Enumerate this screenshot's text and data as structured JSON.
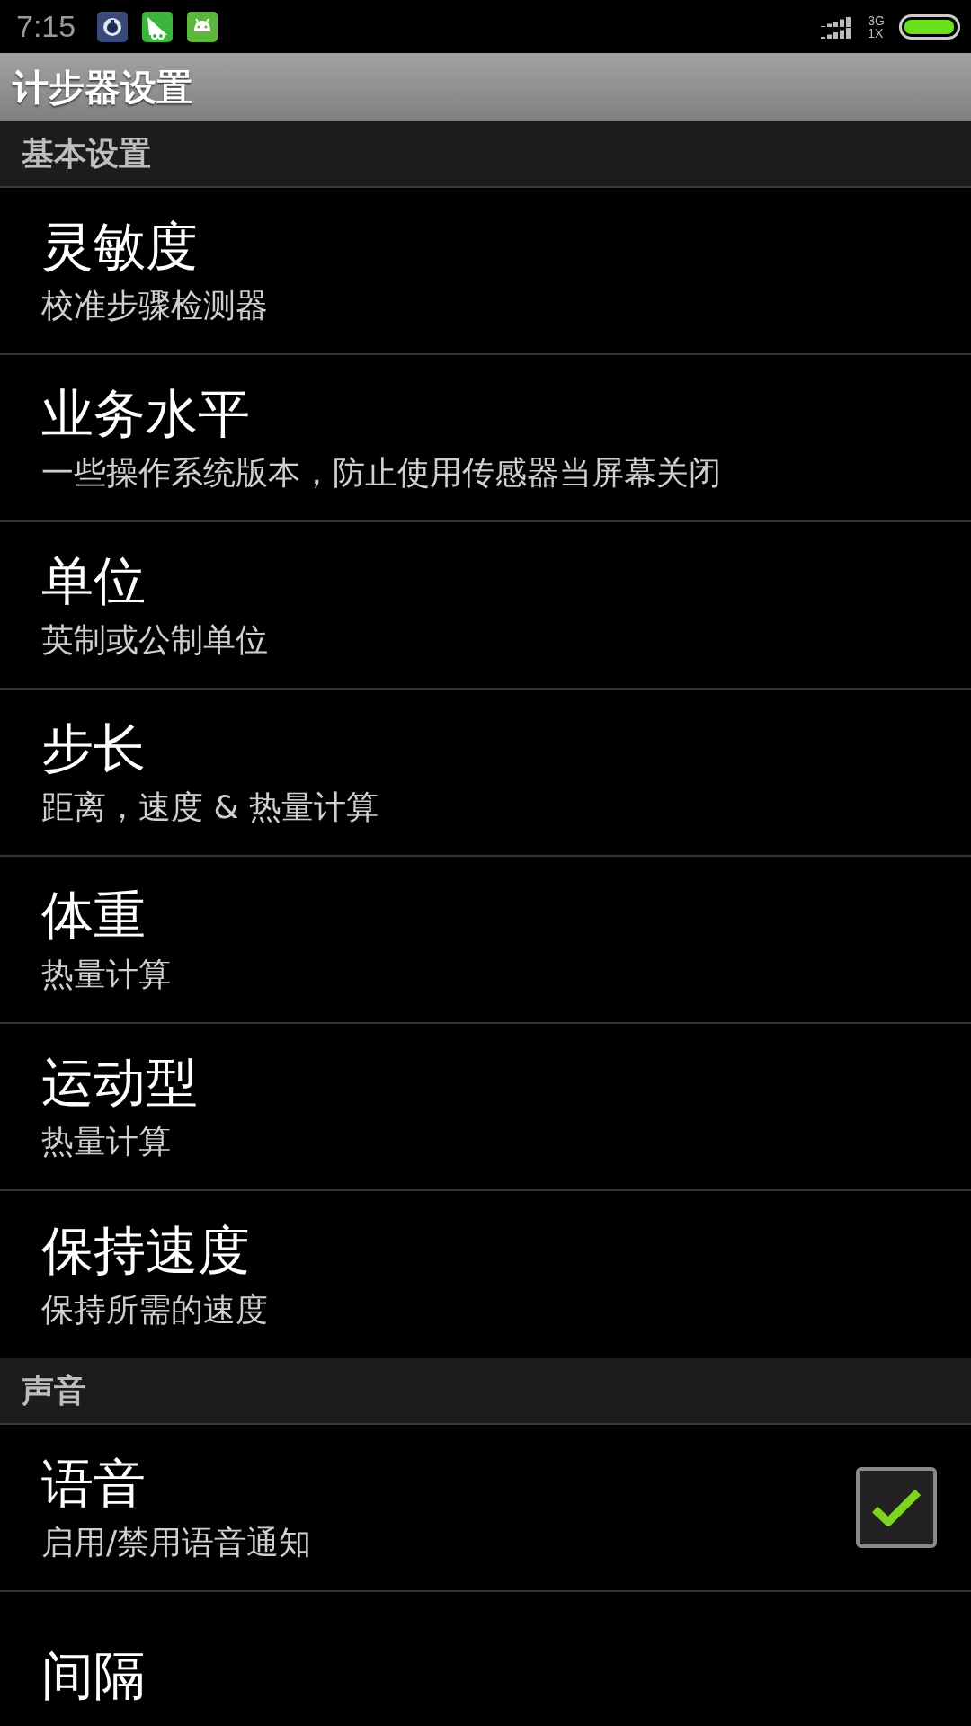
{
  "status_bar": {
    "time": "7:15",
    "network_top": "3G",
    "network_bottom": "1X"
  },
  "title_bar": {
    "title": "计步器设置"
  },
  "sections": [
    {
      "header": "基本设置",
      "items": [
        {
          "kind": "plain",
          "title": "灵敏度",
          "summary": "校准步骤检测器"
        },
        {
          "kind": "plain",
          "title": "业务水平",
          "summary": "一些操作系统版本，防止使用传感器当屏幕关闭"
        },
        {
          "kind": "plain",
          "title": "单位",
          "summary": "英制或公制单位"
        },
        {
          "kind": "plain",
          "title": "步长",
          "summary": "距离，速度 & 热量计算"
        },
        {
          "kind": "plain",
          "title": "体重",
          "summary": "热量计算"
        },
        {
          "kind": "plain",
          "title": "运动型",
          "summary": "热量计算"
        },
        {
          "kind": "plain",
          "title": "保持速度",
          "summary": "保持所需的速度"
        }
      ]
    },
    {
      "header": "声音",
      "items": [
        {
          "kind": "checkbox",
          "title": "语音",
          "summary": "启用/禁用语音通知",
          "checked": true
        },
        {
          "kind": "plain",
          "title": "间隔"
        }
      ]
    }
  ]
}
